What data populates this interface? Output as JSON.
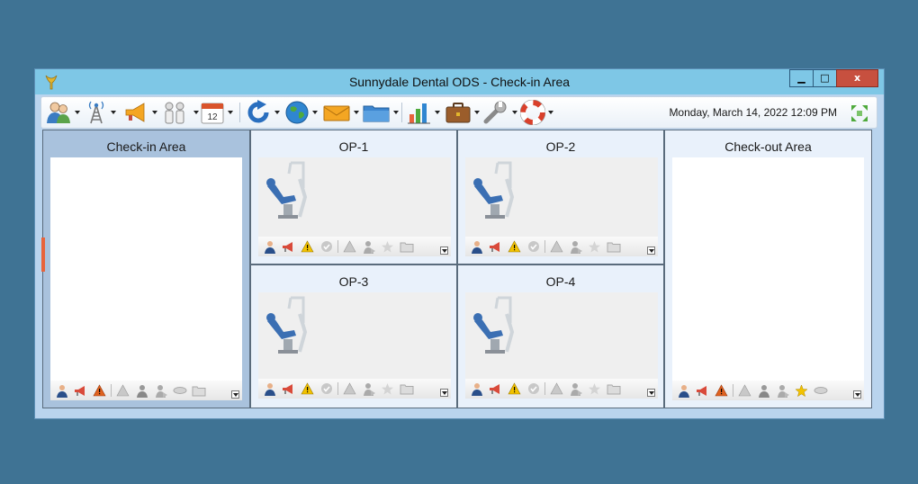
{
  "window": {
    "title": "Sunnydale Dental ODS - Check-in Area",
    "controls": {
      "minimize": "▁",
      "maximize": "□",
      "close": "x"
    }
  },
  "toolbar": {
    "datetime": "Monday, March 14, 2022 12:09 PM",
    "calendar_day": "12",
    "tools": [
      {
        "name": "patients-tool",
        "icon": "people-icon"
      },
      {
        "name": "network-tool",
        "icon": "antenna-tower-icon"
      },
      {
        "name": "announce-tool",
        "icon": "megaphone-icon"
      },
      {
        "name": "staff-tool",
        "icon": "staff-icon"
      },
      {
        "name": "calendar-tool",
        "icon": "calendar-icon"
      },
      {
        "name": "refresh-tool",
        "icon": "refresh-icon"
      },
      {
        "name": "web-tool",
        "icon": "globe-icon"
      },
      {
        "name": "mail-tool",
        "icon": "envelope-icon"
      },
      {
        "name": "folder-tool",
        "icon": "folder-icon"
      },
      {
        "name": "reports-tool",
        "icon": "bar-chart-icon"
      },
      {
        "name": "toolbox-tool",
        "icon": "briefcase-icon"
      },
      {
        "name": "settings-tool",
        "icon": "wrench-icon"
      },
      {
        "name": "help-tool",
        "icon": "lifebuoy-icon"
      }
    ]
  },
  "panels": {
    "checkin": {
      "title": "Check-in Area"
    },
    "op1": {
      "title": "OP-1"
    },
    "op2": {
      "title": "OP-2"
    },
    "op3": {
      "title": "OP-3"
    },
    "op4": {
      "title": "OP-4"
    },
    "checkout": {
      "title": "Check-out Area"
    }
  },
  "status_icons": [
    "patient-icon",
    "megaphone-icon",
    "warning-icon",
    "checkmark-icon",
    "alert-gray-icon",
    "person-gray-icon",
    "star-icon",
    "folder-gray-icon"
  ],
  "colors": {
    "titlebar": "#7ec7e6",
    "close": "#c7503f",
    "desktop": "#3f7394",
    "panel": "#e9f1fb",
    "star_active": "#f2c200"
  }
}
